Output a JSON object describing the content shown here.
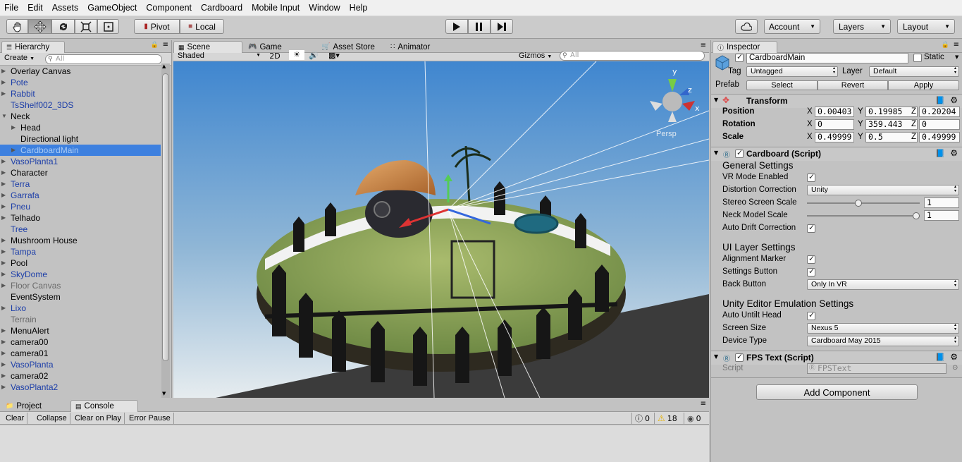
{
  "menubar": {
    "items": [
      "File",
      "Edit",
      "Assets",
      "GameObject",
      "Component",
      "Cardboard",
      "Mobile Input",
      "Window",
      "Help"
    ]
  },
  "toolbar": {
    "pivot": "Pivot",
    "local": "Local",
    "account": "Account",
    "layers": "Layers",
    "layout": "Layout"
  },
  "hierarchy": {
    "tab": "Hierarchy",
    "create": "Create",
    "search_placeholder": "All",
    "items": [
      {
        "label": "Overlay Canvas",
        "indent": 0,
        "arrow": true,
        "color": "black"
      },
      {
        "label": "Pote",
        "indent": 0,
        "arrow": true,
        "color": "blue"
      },
      {
        "label": "Rabbit",
        "indent": 0,
        "arrow": true,
        "color": "blue"
      },
      {
        "label": "TsShelf002_3DS",
        "indent": 0,
        "arrow": false,
        "color": "blue"
      },
      {
        "label": "Neck",
        "indent": 0,
        "arrow": true,
        "open": true,
        "color": "black"
      },
      {
        "label": "Head",
        "indent": 1,
        "arrow": true,
        "color": "black"
      },
      {
        "label": "Directional light",
        "indent": 1,
        "arrow": false,
        "color": "black"
      },
      {
        "label": "CardboardMain",
        "indent": 1,
        "arrow": true,
        "color": "selected"
      },
      {
        "label": "VasoPlanta1",
        "indent": 0,
        "arrow": true,
        "color": "blue"
      },
      {
        "label": "Character",
        "indent": 0,
        "arrow": true,
        "color": "black"
      },
      {
        "label": "Terra",
        "indent": 0,
        "arrow": true,
        "color": "blue"
      },
      {
        "label": "Garrafa",
        "indent": 0,
        "arrow": true,
        "color": "blue"
      },
      {
        "label": "Pneu",
        "indent": 0,
        "arrow": true,
        "color": "blue"
      },
      {
        "label": "Telhado",
        "indent": 0,
        "arrow": true,
        "color": "black"
      },
      {
        "label": "Tree",
        "indent": 0,
        "arrow": false,
        "color": "blue"
      },
      {
        "label": "Mushroom House",
        "indent": 0,
        "arrow": true,
        "color": "black"
      },
      {
        "label": "Tampa",
        "indent": 0,
        "arrow": true,
        "color": "blue"
      },
      {
        "label": "Pool",
        "indent": 0,
        "arrow": true,
        "color": "black"
      },
      {
        "label": "SkyDome",
        "indent": 0,
        "arrow": true,
        "color": "blue"
      },
      {
        "label": "Floor Canvas",
        "indent": 0,
        "arrow": true,
        "color": "gray"
      },
      {
        "label": "EventSystem",
        "indent": 0,
        "arrow": false,
        "color": "black"
      },
      {
        "label": "Lixo",
        "indent": 0,
        "arrow": true,
        "color": "blue"
      },
      {
        "label": "Terrain",
        "indent": 0,
        "arrow": false,
        "color": "gray"
      },
      {
        "label": "MenuAlert",
        "indent": 0,
        "arrow": true,
        "color": "black"
      },
      {
        "label": "camera00",
        "indent": 0,
        "arrow": true,
        "color": "black"
      },
      {
        "label": "camera01",
        "indent": 0,
        "arrow": true,
        "color": "black"
      },
      {
        "label": "VasoPlanta",
        "indent": 0,
        "arrow": true,
        "color": "blue"
      },
      {
        "label": "camera02",
        "indent": 0,
        "arrow": true,
        "color": "black"
      },
      {
        "label": "VasoPlanta2",
        "indent": 0,
        "arrow": true,
        "color": "blue"
      }
    ]
  },
  "scene": {
    "tabs": [
      "Scene",
      "Game",
      "Asset Store",
      "Animator"
    ],
    "shading": "Shaded",
    "mode_2d": "2D",
    "gizmos": "Gizmos",
    "search_placeholder": "All",
    "persp_label": "Persp",
    "gizmo_axes": {
      "y": "y",
      "z": "z",
      "x": "x"
    }
  },
  "inspector": {
    "tab": "Inspector",
    "object_name": "CardboardMain",
    "static_label": "Static",
    "tag_label": "Tag",
    "tag_value": "Untagged",
    "layer_label": "Layer",
    "layer_value": "Default",
    "prefab_label": "Prefab",
    "prefab_buttons": [
      "Select",
      "Revert",
      "Apply"
    ],
    "transform": {
      "title": "Transform",
      "position": {
        "label": "Position",
        "x": "0.00403",
        "y": "0.19985",
        "z": "0.20204"
      },
      "rotation": {
        "label": "Rotation",
        "x": "0",
        "y": "359.443",
        "z": "0"
      },
      "scale": {
        "label": "Scale",
        "x": "0.49999",
        "y": "0.5",
        "z": "0.49999"
      }
    },
    "cardboard": {
      "title": "Cardboard (Script)",
      "general": "General Settings",
      "vr_mode": "VR Mode Enabled",
      "distortion": "Distortion Correction",
      "distortion_value": "Unity",
      "stereo": "Stereo Screen Scale",
      "stereo_value": "1",
      "stereo_level": 0.45,
      "neck": "Neck Model Scale",
      "neck_value": "1",
      "neck_level": 1.0,
      "auto_drift": "Auto Drift Correction",
      "ui_layer": "UI Layer Settings",
      "alignment": "Alignment Marker",
      "settings_btn": "Settings Button",
      "back_btn": "Back Button",
      "back_value": "Only In VR",
      "emulation": "Unity Editor Emulation Settings",
      "auto_untilt": "Auto Untilt Head",
      "screen_size": "Screen Size",
      "screen_value": "Nexus 5",
      "device_type": "Device Type",
      "device_value": "Cardboard May 2015"
    },
    "fps": {
      "title": "FPS Text (Script)",
      "script_label": "Script",
      "script_value": "FPSText"
    },
    "add_component": "Add Component"
  },
  "bottom": {
    "tabs": [
      "Project",
      "Console"
    ],
    "buttons": [
      "Clear",
      "Collapse",
      "Clear on Play",
      "Error Pause"
    ],
    "counts": {
      "info": "0",
      "warn": "18",
      "error": "0"
    }
  },
  "colors": {
    "selection": "#3d80df",
    "sky_top": "#4a8ccf",
    "sky_bottom": "#dfe8ee"
  }
}
